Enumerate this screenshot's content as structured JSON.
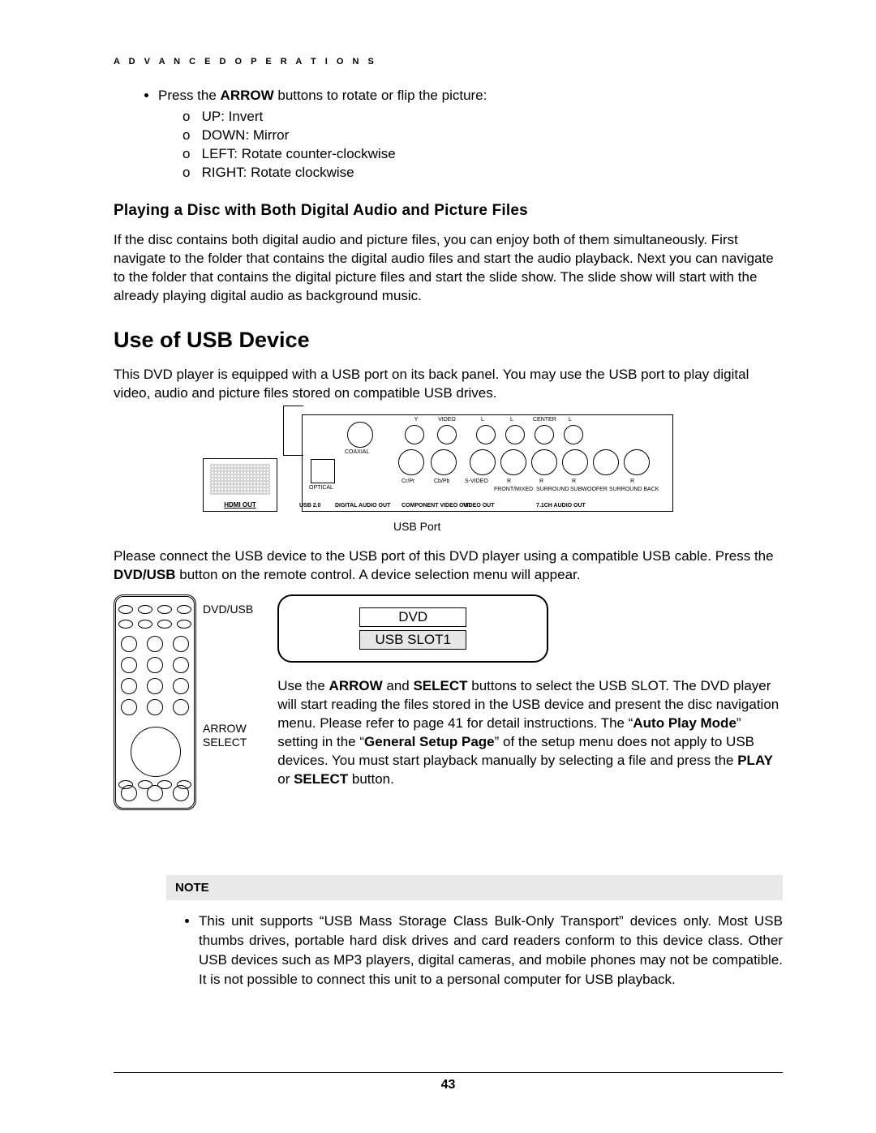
{
  "header": {
    "running_head": "A D V A N C E D   O P E R A T I O N S"
  },
  "arrow_section": {
    "lead_prefix": "Press the ",
    "lead_bold": "ARROW",
    "lead_suffix": " buttons to rotate or flip the picture:",
    "items": [
      "UP: Invert",
      "DOWN: Mirror",
      "LEFT: Rotate counter-clockwise",
      "RIGHT: Rotate clockwise"
    ]
  },
  "section_dual": {
    "title": "Playing a Disc with Both Digital Audio and Picture Files",
    "body": "If the disc contains both digital audio and picture files, you can enjoy both of them simultaneously.  First navigate to the folder that contains the digital audio files and start the audio playback.  Next you can navigate to the folder that contains the digital picture files and start the slide show.  The slide show will start with the already playing digital audio as background music."
  },
  "section_usb": {
    "title": "Use of USB Device",
    "intro": "This DVD player is equipped with a USB port on its back panel. You may use the USB port to play digital video, audio and picture files stored on compatible USB drives.",
    "hdmi_label": "HDMI OUT",
    "backpanel": {
      "top_labels": [
        "Y",
        "VIDEO",
        "L",
        "L",
        "CENTER",
        "L"
      ],
      "mid_labels": [
        "COAXIAL"
      ],
      "low_labels": [
        "OPTICAL",
        "Cr/Pr",
        "Cb/Pb",
        "S-VIDEO",
        "R",
        "R",
        "R",
        "R"
      ],
      "low_labels2": [
        "FRONT/MIXED",
        "SURROUND",
        "SUBWOOFER",
        "SURROUND BACK"
      ],
      "bottom_labels": [
        "USB 2.0",
        "DIGITAL AUDIO OUT",
        "COMPONENT VIDEO OUT",
        "VIDEO OUT",
        "7.1CH AUDIO OUT"
      ]
    },
    "usb_port_caption": "USB Port",
    "connect_para_parts": [
      "Please connect the USB device to the USB port of this DVD player using a compatible USB cable.  Press the ",
      "DVD/USB",
      " button on the remote control.  A device selection menu will appear."
    ],
    "remote_labels": {
      "dvdusb": "DVD/USB",
      "arrow": "ARROW",
      "select": "SELECT"
    },
    "slot_menu": {
      "line1": "DVD",
      "line2": "USB SLOT1"
    },
    "use_para": {
      "p1a": "Use the ",
      "p1b": "ARROW",
      "p1c": " and ",
      "p1d": "SELECT",
      "p1e": " buttons to select the USB SLOT.  The DVD player will start reading the files stored in the USB device and present the disc navigation menu.  Please refer to page 41 for detail instructions.  The “",
      "p1f": "Auto Play Mode",
      "p1g": "” setting in the “",
      "p1h": "General Setup Page",
      "p1i": "” of the setup menu does not apply to USB devices.  You must start playback manually by selecting a file and press the ",
      "p1j": "PLAY",
      "p1k": " or ",
      "p1l": "SELECT",
      "p1m": " button."
    }
  },
  "note": {
    "title": "NOTE",
    "body": "This unit supports “USB Mass Storage Class Bulk-Only Transport” devices only. Most USB thumbs drives, portable hard disk drives and card readers conform to this device class.  Other USB devices such as MP3 players, digital cameras, and mobile phones may not be compatible. It is not possible to connect this unit to a personal computer for USB playback."
  },
  "footer": {
    "page_number": "43"
  }
}
